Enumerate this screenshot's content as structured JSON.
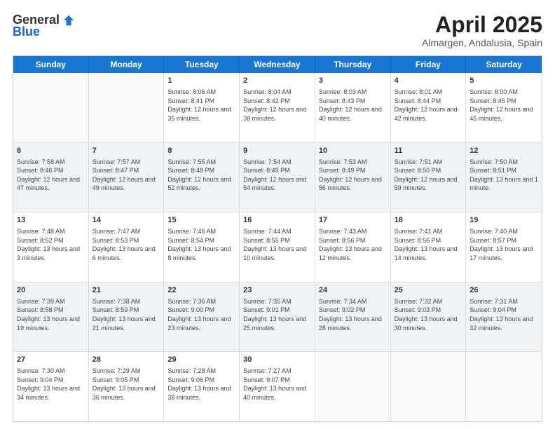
{
  "logo": {
    "general": "General",
    "blue": "Blue"
  },
  "title": {
    "month": "April 2025",
    "location": "Almargen, Andalusia, Spain"
  },
  "header": {
    "days": [
      "Sunday",
      "Monday",
      "Tuesday",
      "Wednesday",
      "Thursday",
      "Friday",
      "Saturday"
    ]
  },
  "weeks": [
    [
      {
        "day": "",
        "sunrise": "",
        "sunset": "",
        "daylight": "",
        "empty": true
      },
      {
        "day": "",
        "sunrise": "",
        "sunset": "",
        "daylight": "",
        "empty": true
      },
      {
        "day": "1",
        "sunrise": "Sunrise: 8:06 AM",
        "sunset": "Sunset: 8:41 PM",
        "daylight": "Daylight: 12 hours and 35 minutes.",
        "empty": false
      },
      {
        "day": "2",
        "sunrise": "Sunrise: 8:04 AM",
        "sunset": "Sunset: 8:42 PM",
        "daylight": "Daylight: 12 hours and 38 minutes.",
        "empty": false
      },
      {
        "day": "3",
        "sunrise": "Sunrise: 8:03 AM",
        "sunset": "Sunset: 8:43 PM",
        "daylight": "Daylight: 12 hours and 40 minutes.",
        "empty": false
      },
      {
        "day": "4",
        "sunrise": "Sunrise: 8:01 AM",
        "sunset": "Sunset: 8:44 PM",
        "daylight": "Daylight: 12 hours and 42 minutes.",
        "empty": false
      },
      {
        "day": "5",
        "sunrise": "Sunrise: 8:00 AM",
        "sunset": "Sunset: 8:45 PM",
        "daylight": "Daylight: 12 hours and 45 minutes.",
        "empty": false
      }
    ],
    [
      {
        "day": "6",
        "sunrise": "Sunrise: 7:58 AM",
        "sunset": "Sunset: 8:46 PM",
        "daylight": "Daylight: 12 hours and 47 minutes.",
        "empty": false
      },
      {
        "day": "7",
        "sunrise": "Sunrise: 7:57 AM",
        "sunset": "Sunset: 8:47 PM",
        "daylight": "Daylight: 12 hours and 49 minutes.",
        "empty": false
      },
      {
        "day": "8",
        "sunrise": "Sunrise: 7:55 AM",
        "sunset": "Sunset: 8:48 PM",
        "daylight": "Daylight: 12 hours and 52 minutes.",
        "empty": false
      },
      {
        "day": "9",
        "sunrise": "Sunrise: 7:54 AM",
        "sunset": "Sunset: 8:49 PM",
        "daylight": "Daylight: 12 hours and 54 minutes.",
        "empty": false
      },
      {
        "day": "10",
        "sunrise": "Sunrise: 7:53 AM",
        "sunset": "Sunset: 8:49 PM",
        "daylight": "Daylight: 12 hours and 56 minutes.",
        "empty": false
      },
      {
        "day": "11",
        "sunrise": "Sunrise: 7:51 AM",
        "sunset": "Sunset: 8:50 PM",
        "daylight": "Daylight: 12 hours and 59 minutes.",
        "empty": false
      },
      {
        "day": "12",
        "sunrise": "Sunrise: 7:50 AM",
        "sunset": "Sunset: 8:51 PM",
        "daylight": "Daylight: 13 hours and 1 minute.",
        "empty": false
      }
    ],
    [
      {
        "day": "13",
        "sunrise": "Sunrise: 7:48 AM",
        "sunset": "Sunset: 8:52 PM",
        "daylight": "Daylight: 13 hours and 3 minutes.",
        "empty": false
      },
      {
        "day": "14",
        "sunrise": "Sunrise: 7:47 AM",
        "sunset": "Sunset: 8:53 PM",
        "daylight": "Daylight: 13 hours and 6 minutes.",
        "empty": false
      },
      {
        "day": "15",
        "sunrise": "Sunrise: 7:46 AM",
        "sunset": "Sunset: 8:54 PM",
        "daylight": "Daylight: 13 hours and 8 minutes.",
        "empty": false
      },
      {
        "day": "16",
        "sunrise": "Sunrise: 7:44 AM",
        "sunset": "Sunset: 8:55 PM",
        "daylight": "Daylight: 13 hours and 10 minutes.",
        "empty": false
      },
      {
        "day": "17",
        "sunrise": "Sunrise: 7:43 AM",
        "sunset": "Sunset: 8:56 PM",
        "daylight": "Daylight: 13 hours and 12 minutes.",
        "empty": false
      },
      {
        "day": "18",
        "sunrise": "Sunrise: 7:41 AM",
        "sunset": "Sunset: 8:56 PM",
        "daylight": "Daylight: 13 hours and 14 minutes.",
        "empty": false
      },
      {
        "day": "19",
        "sunrise": "Sunrise: 7:40 AM",
        "sunset": "Sunset: 8:57 PM",
        "daylight": "Daylight: 13 hours and 17 minutes.",
        "empty": false
      }
    ],
    [
      {
        "day": "20",
        "sunrise": "Sunrise: 7:39 AM",
        "sunset": "Sunset: 8:58 PM",
        "daylight": "Daylight: 13 hours and 19 minutes.",
        "empty": false
      },
      {
        "day": "21",
        "sunrise": "Sunrise: 7:38 AM",
        "sunset": "Sunset: 8:59 PM",
        "daylight": "Daylight: 13 hours and 21 minutes.",
        "empty": false
      },
      {
        "day": "22",
        "sunrise": "Sunrise: 7:36 AM",
        "sunset": "Sunset: 9:00 PM",
        "daylight": "Daylight: 13 hours and 23 minutes.",
        "empty": false
      },
      {
        "day": "23",
        "sunrise": "Sunrise: 7:35 AM",
        "sunset": "Sunset: 9:01 PM",
        "daylight": "Daylight: 13 hours and 25 minutes.",
        "empty": false
      },
      {
        "day": "24",
        "sunrise": "Sunrise: 7:34 AM",
        "sunset": "Sunset: 9:02 PM",
        "daylight": "Daylight: 13 hours and 28 minutes.",
        "empty": false
      },
      {
        "day": "25",
        "sunrise": "Sunrise: 7:32 AM",
        "sunset": "Sunset: 9:03 PM",
        "daylight": "Daylight: 13 hours and 30 minutes.",
        "empty": false
      },
      {
        "day": "26",
        "sunrise": "Sunrise: 7:31 AM",
        "sunset": "Sunset: 9:04 PM",
        "daylight": "Daylight: 13 hours and 32 minutes.",
        "empty": false
      }
    ],
    [
      {
        "day": "27",
        "sunrise": "Sunrise: 7:30 AM",
        "sunset": "Sunset: 9:04 PM",
        "daylight": "Daylight: 13 hours and 34 minutes.",
        "empty": false
      },
      {
        "day": "28",
        "sunrise": "Sunrise: 7:29 AM",
        "sunset": "Sunset: 9:05 PM",
        "daylight": "Daylight: 13 hours and 36 minutes.",
        "empty": false
      },
      {
        "day": "29",
        "sunrise": "Sunrise: 7:28 AM",
        "sunset": "Sunset: 9:06 PM",
        "daylight": "Daylight: 13 hours and 38 minutes.",
        "empty": false
      },
      {
        "day": "30",
        "sunrise": "Sunrise: 7:27 AM",
        "sunset": "Sunset: 9:07 PM",
        "daylight": "Daylight: 13 hours and 40 minutes.",
        "empty": false
      },
      {
        "day": "",
        "sunrise": "",
        "sunset": "",
        "daylight": "",
        "empty": true
      },
      {
        "day": "",
        "sunrise": "",
        "sunset": "",
        "daylight": "",
        "empty": true
      },
      {
        "day": "",
        "sunrise": "",
        "sunset": "",
        "daylight": "",
        "empty": true
      }
    ]
  ]
}
